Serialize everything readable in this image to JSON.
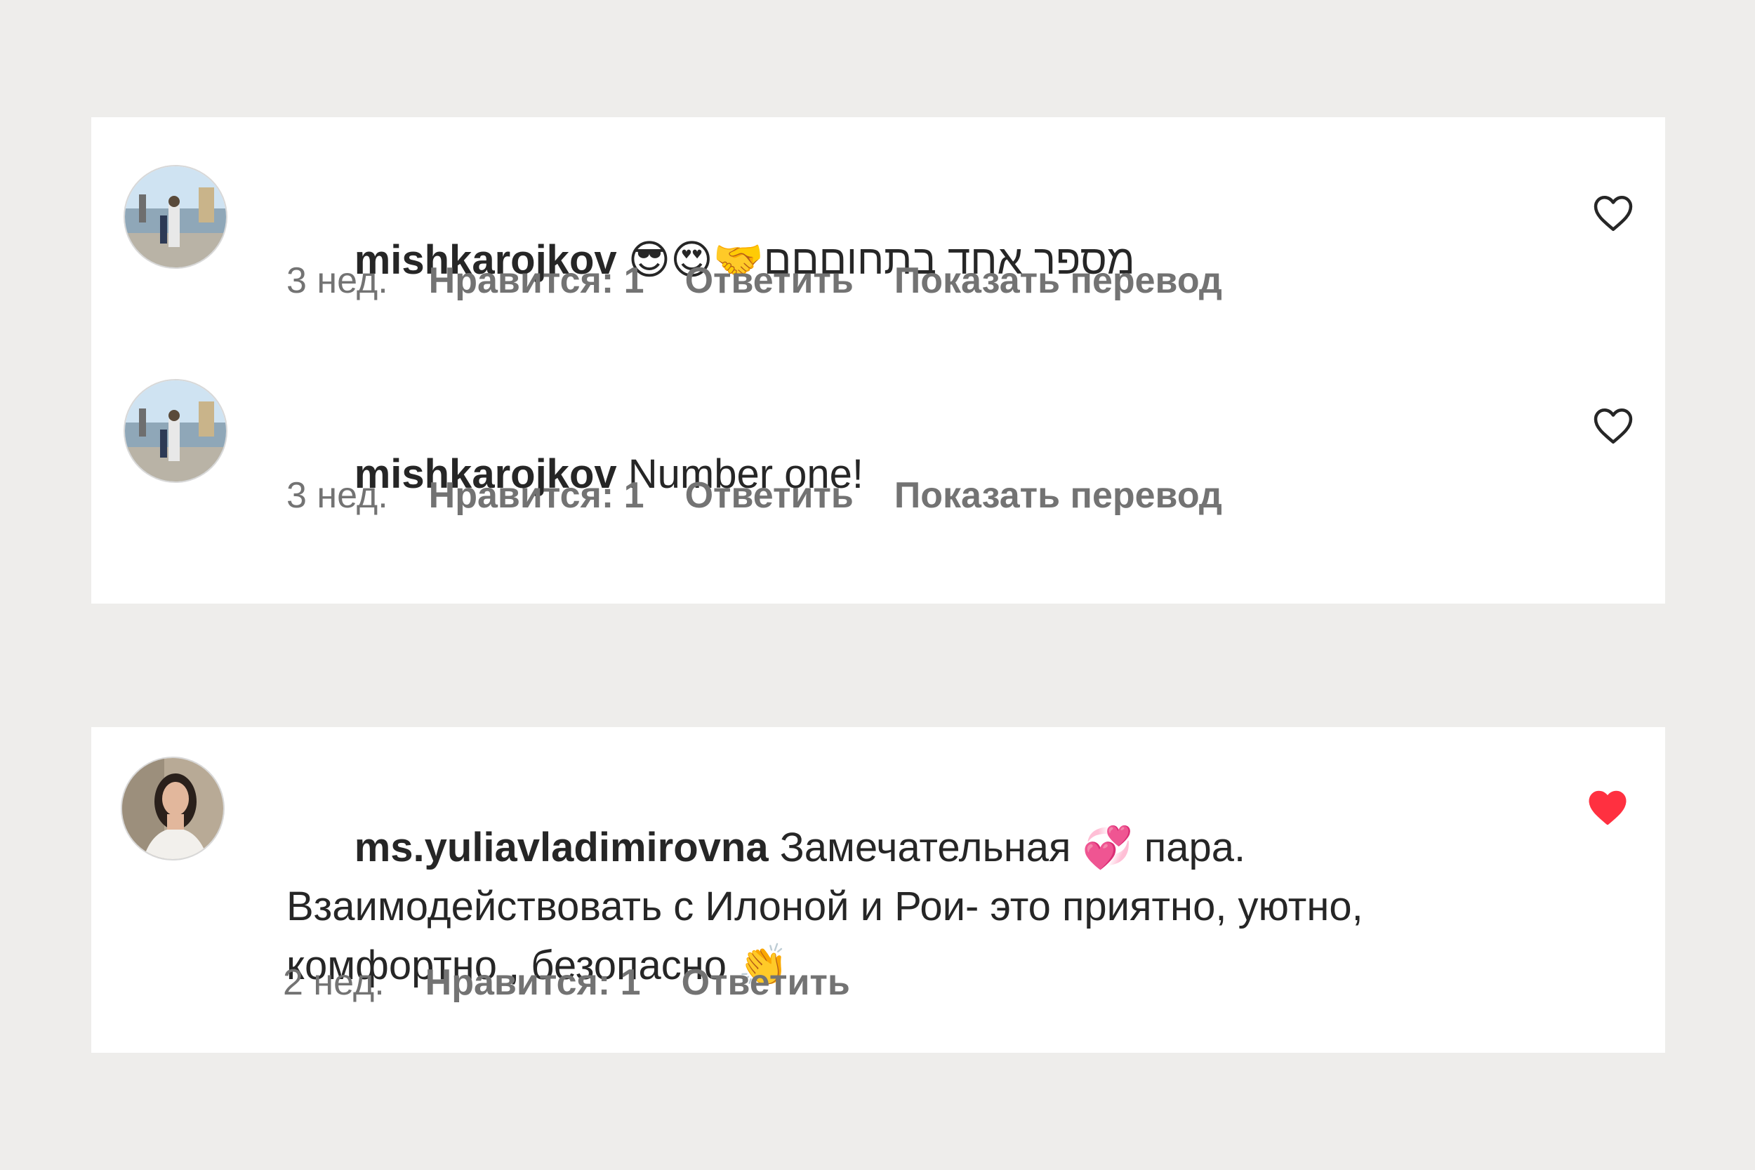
{
  "comments": [
    {
      "username": "mishkarojkov",
      "text": "😎😍🤝מספר אחד בתחוםםם",
      "time": "3 нед.",
      "likes": "Нравится: 1",
      "reply": "Ответить",
      "translate": "Показать перевод",
      "liked": false
    },
    {
      "username": "mishkarojkov",
      "text": "Number one!",
      "time": "3 нед.",
      "likes": "Нравится: 1",
      "reply": "Ответить",
      "translate": "Показать перевод",
      "liked": false
    },
    {
      "username": "ms.yuliavladimirovna",
      "text": "Замечательная 💞 пара. Взаимодействовать с Илоной и Рои- это приятно, уютно, комфортно , безопасно 👏",
      "time": "2 нед.",
      "likes": "Нравится: 1",
      "reply": "Ответить",
      "liked": true
    }
  ],
  "colors": {
    "background": "#eeedeb",
    "card": "#ffffff",
    "text": "#262626",
    "meta": "#737373",
    "like_active": "#ff3040"
  }
}
